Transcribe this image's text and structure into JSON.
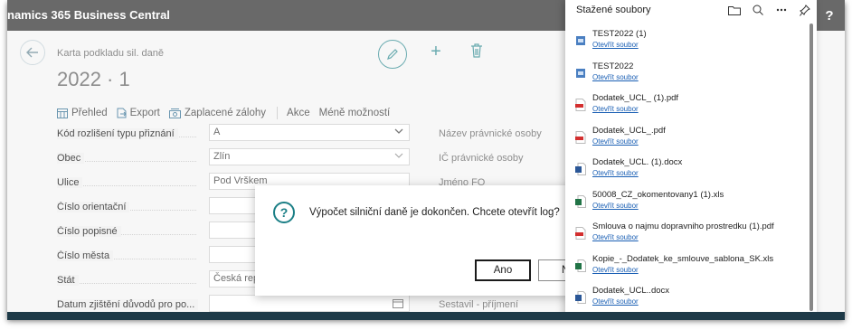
{
  "app": {
    "title": "namics 365 Business Central",
    "help_label": "?"
  },
  "header": {
    "breadcrumb": "Karta podkladu sil. daně",
    "title": "2022 · 1"
  },
  "actions": [
    {
      "label": "Přehled",
      "icon": "table-icon"
    },
    {
      "label": "Export",
      "icon": "export-icon"
    },
    {
      "label": "Zaplacené zálohy",
      "icon": "payments-icon"
    },
    {
      "label": "Akce"
    },
    {
      "label": "Méně možností"
    }
  ],
  "fields": [
    {
      "label": "Kód rozlišení typu přiznání",
      "value": "A",
      "type": "select"
    },
    {
      "label": "Obec",
      "value": "Zlín",
      "type": "select"
    },
    {
      "label": "Ulice",
      "value": "Pod Vrškem",
      "type": "text"
    },
    {
      "label": "Číslo orientační",
      "value": "",
      "type": "text"
    },
    {
      "label": "Číslo popisné",
      "value": "",
      "type": "text"
    },
    {
      "label": "Číslo města",
      "value": "",
      "type": "text"
    },
    {
      "label": "Stát",
      "value": "Česká rep",
      "type": "text"
    },
    {
      "label": "Datum zjištění důvodů pro po...",
      "value": "",
      "type": "date"
    }
  ],
  "right_fields": [
    "Název právnické osoby",
    "IČ právnické osoby",
    "Jméno FO",
    "Sestavil - příjmení"
  ],
  "dialog": {
    "message": "Výpočet silniční daně je dokončen. Chcete otevřít log?",
    "yes_label": "Ano",
    "no_label": "N"
  },
  "downloads": {
    "title": "Stažené soubory",
    "open_label": "Otevřít soubor",
    "items": [
      {
        "name": "TEST2022 (1)",
        "icon": "package-icon",
        "color": "#4a7fc1"
      },
      {
        "name": "TEST2022",
        "icon": "package-icon",
        "color": "#4a7fc1"
      },
      {
        "name": "Dodatek_UCL_ (1).pdf",
        "icon": "pdf-icon",
        "color": "#d32f2f"
      },
      {
        "name": "Dodatek_UCL_.pdf",
        "icon": "pdf-icon",
        "color": "#d32f2f"
      },
      {
        "name": "Dodatek_UCL. (1).docx",
        "icon": "word-icon",
        "color": "#2b5797"
      },
      {
        "name": "50008_CZ_okomentovany1 (1).xls",
        "icon": "excel-icon",
        "color": "#217346"
      },
      {
        "name": "Smlouva o najmu dopravniho prostredku (1).pdf",
        "icon": "pdf-icon",
        "color": "#d32f2f"
      },
      {
        "name": "Kopie_-_Dodatek_ke_smlouve_sablona_SK.xls",
        "icon": "excel-icon",
        "color": "#217346"
      },
      {
        "name": "Dodatek_UCL..docx",
        "icon": "word-icon",
        "color": "#2b5797"
      }
    ]
  }
}
